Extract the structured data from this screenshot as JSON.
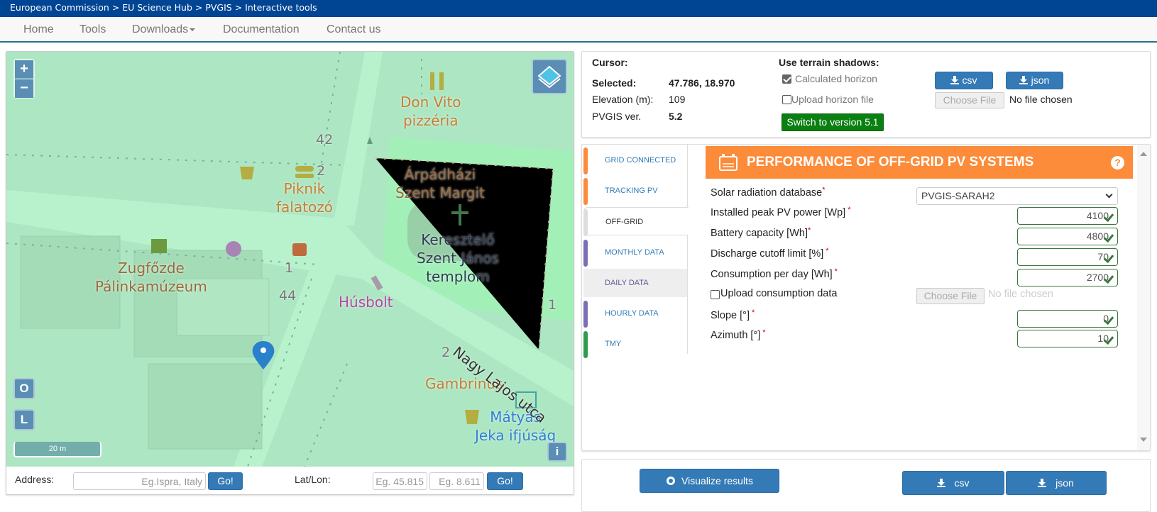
{
  "breadcrumb": "European Commission > EU Science Hub > PVGIS > Interactive tools",
  "nav": {
    "items": [
      {
        "label": "Home"
      },
      {
        "label": "Tools"
      },
      {
        "label": "Downloads",
        "dropdown": true
      },
      {
        "label": "Documentation"
      },
      {
        "label": "Contact us"
      }
    ]
  },
  "map": {
    "zoom_in": "+",
    "zoom_out": "−",
    "btn_o": "O",
    "btn_l": "L",
    "info": "i",
    "scale": "20 m",
    "labels": {
      "don_vito": "Don Vito\npizzéria",
      "arpadhazi": "Árpádházi\nSzent Margit",
      "keresztelo": "Keresztelő\nSzent János\ntemplom",
      "piknik": "Piknik\nfalatozó",
      "zugfozde": "Zugfőzde\nPálinkamúzeum",
      "husbolt": "Húsbolt",
      "gambrinus": "Gambrinus",
      "matyas": "Mátyás\nJeka ifjúság",
      "street": "Nagy Lajos utca",
      "num_42": "42",
      "num_2a": "2",
      "num_44": "44",
      "num_1a": "1",
      "num_1b": "1",
      "num_2b": "2"
    },
    "colors": {
      "marker": "#2a81cb",
      "poi": "#c77d2a"
    }
  },
  "address_bar": {
    "address_label": "Address:",
    "address_placeholder": "Eg.Ispra, Italy",
    "go_label": "Go!",
    "latlon_label": "Lat/Lon:",
    "lat_placeholder": "Eg. 45.815",
    "lon_placeholder": "Eg. 8.611"
  },
  "info": {
    "cursor_label": "Cursor:",
    "selected_label": "Selected:",
    "selected_value": "47.786, 18.970",
    "elevation_label": "Elevation (m):",
    "elevation_value": "109",
    "version_label": "PVGIS ver.",
    "version_value": "5.2",
    "terrain_title": "Use terrain shadows:",
    "calc_horizon": "Calculated horizon",
    "calc_horizon_checked": true,
    "upload_horizon": "Upload horizon file",
    "switch_version": "Switch to version 5.1",
    "csv": "csv",
    "json": "json",
    "choose_file": "Choose File",
    "no_file": "No file chosen"
  },
  "tabs": [
    {
      "label": "GRID CONNECTED",
      "color": "#fc8b3a"
    },
    {
      "label": "TRACKING PV",
      "color": "#fc8b3a"
    },
    {
      "label": "OFF-GRID",
      "color": "#dddddd",
      "active": true
    },
    {
      "label": "MONTHLY DATA",
      "color": "#7b6fb4"
    },
    {
      "label": "DAILY DATA",
      "color": "#eeeeee"
    },
    {
      "label": "HOURLY DATA",
      "color": "#7b6fb4"
    },
    {
      "label": "TMY",
      "color": "#2e9b4e"
    }
  ],
  "offgrid": {
    "title": "PERFORMANCE OF OFF-GRID PV SYSTEMS",
    "accent": "#fc8b3a",
    "help": "?",
    "db_label": "Solar radiation database",
    "db_value": "PVGIS-SARAH2",
    "fields": [
      {
        "label": "Installed peak PV power [Wp]",
        "value": "4100"
      },
      {
        "label": "Battery capacity [Wh]",
        "value": "4800"
      },
      {
        "label": "Discharge cutoff limit [%]",
        "value": "70"
      },
      {
        "label": "Consumption per day [Wh]",
        "value": "2700"
      }
    ],
    "upload_consumption": "Upload consumption data",
    "choose_file": "Choose File",
    "no_file": "No file chosen",
    "slope_label": "Slope [°]",
    "slope_value": "0",
    "azimuth_label": "Azimuth [°]",
    "azimuth_value": "10",
    "required_mark": "*"
  },
  "results": {
    "visualize": "Visualize results",
    "csv": "csv",
    "json": "json"
  }
}
